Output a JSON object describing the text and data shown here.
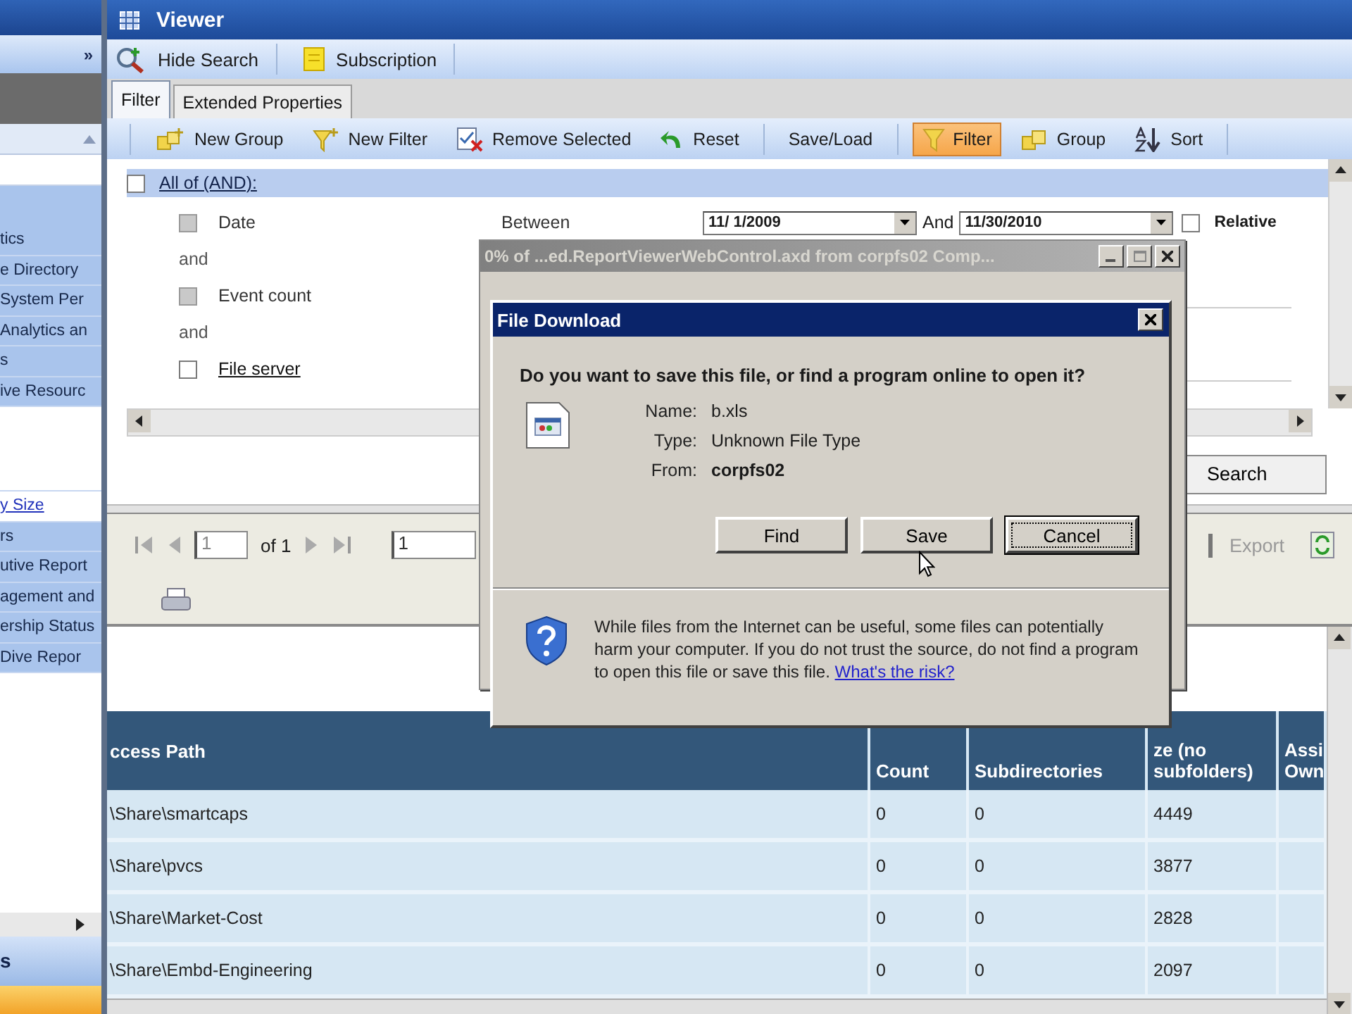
{
  "sidebar": {
    "collapse": "»",
    "items": [
      {
        "kind": "item",
        "label": "tics"
      },
      {
        "kind": "item",
        "label": "e Directory"
      },
      {
        "kind": "item",
        "label": "System Per"
      },
      {
        "kind": "item",
        "label": "Analytics an"
      },
      {
        "kind": "item",
        "label": "s"
      },
      {
        "kind": "item",
        "label": "ive Resourc"
      },
      {
        "kind": "blank"
      },
      {
        "kind": "link",
        "label": "y Size"
      },
      {
        "kind": "item",
        "label": "rs"
      },
      {
        "kind": "item",
        "label": "utive Report"
      },
      {
        "kind": "item",
        "label": "agement and"
      },
      {
        "kind": "item",
        "label": "ership Status"
      },
      {
        "kind": "item",
        "label": "Dive Repor"
      }
    ],
    "section": "s"
  },
  "viewer": {
    "title": "Viewer",
    "toolbar": [
      {
        "label": "Hide Search"
      },
      {
        "label": "Subscription"
      }
    ]
  },
  "tabs": [
    {
      "label": "Filter",
      "selected": true
    },
    {
      "label": "Extended Properties",
      "selected": false
    }
  ],
  "filter_toolbar": {
    "groups": [
      {
        "buttons": [
          {
            "label": "New Group",
            "selected": false
          },
          {
            "label": "New Filter",
            "selected": false
          },
          {
            "label": "Remove Selected",
            "selected": false
          },
          {
            "label": "Reset",
            "selected": false
          }
        ]
      },
      {
        "buttons": [
          {
            "label": "Save/Load",
            "selected": false
          }
        ]
      },
      {
        "buttons": [
          {
            "label": "Filter",
            "selected": true
          },
          {
            "label": "Group",
            "selected": false
          },
          {
            "label": "Sort",
            "selected": false
          }
        ]
      }
    ]
  },
  "filter": {
    "root": {
      "label": "All of (AND):",
      "checked": false
    },
    "conditions": [
      {
        "kind": "range",
        "label": "Date",
        "checked": false,
        "disabled": true,
        "link": false,
        "operator": "Between",
        "from": "11/ 1/2009",
        "joiner": "And",
        "to": "11/30/2010",
        "relative": {
          "label": "Relative",
          "checked": false
        }
      },
      {
        "kind": "connector",
        "label": "and"
      },
      {
        "kind": "value",
        "label": "Event count",
        "checked": false,
        "disabled": true,
        "link": false
      },
      {
        "kind": "connector",
        "label": "and"
      },
      {
        "kind": "value",
        "label": "File server",
        "checked": false,
        "disabled": false,
        "link": true
      }
    ]
  },
  "search_button": "Search",
  "report_toolbar": {
    "page": "1",
    "page_count": "of 1",
    "page_size": "1",
    "export": {
      "label": "Export",
      "disabled": true
    }
  },
  "table": {
    "columns": [
      "ccess Path",
      "Count",
      "Subdirectories",
      "ze (no subfolders)",
      "Assi Own"
    ],
    "rows": [
      [
        "\\Share\\smartcaps",
        "0",
        "0",
        "4449"
      ],
      [
        "\\Share\\pvcs",
        "0",
        "0",
        "3877"
      ],
      [
        "\\Share\\Market-Cost",
        "0",
        "0",
        "2828"
      ],
      [
        "\\Share\\Embd-Engineering",
        "0",
        "0",
        "2097"
      ]
    ]
  },
  "progress_window": {
    "title": "0% of ...ed.ReportViewerWebControl.axd from corpfs02 Comp...",
    "active": false
  },
  "file_download_dialog": {
    "title": "File Download",
    "question": "Do you want to save this file, or find a program online to open it?",
    "fields": [
      {
        "label": "Name:",
        "value": "b.xls",
        "bold": false
      },
      {
        "label": "Type:",
        "value": "Unknown File Type",
        "bold": false
      },
      {
        "label": "From:",
        "value": "corpfs02",
        "bold": true
      }
    ],
    "buttons": [
      {
        "label": "Find",
        "focused": false
      },
      {
        "label": "Save",
        "focused": false
      },
      {
        "label": "Cancel",
        "focused": true
      }
    ],
    "warning": {
      "text": "While files from the Internet can be useful, some files can potentially harm your computer. If you do not trust the source, do not find a program to open this file or save this file.",
      "link": "What's the risk?"
    }
  }
}
